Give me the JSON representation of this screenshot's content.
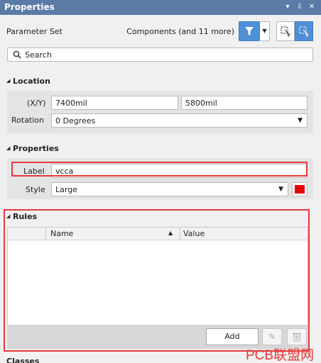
{
  "window": {
    "title": "Properties",
    "controls": [
      "▾",
      "⇩",
      "✕"
    ]
  },
  "parameter_set": {
    "label": "Parameter Set",
    "components": "Components (and 11 more)"
  },
  "search": {
    "placeholder": "Search"
  },
  "location": {
    "heading": "Location",
    "xy_label": "(X/Y)",
    "x_value": "7400mil",
    "y_value": "5800mil",
    "rotation_label": "Rotation",
    "rotation_value": "0 Degrees"
  },
  "properties": {
    "heading": "Properties",
    "label_label": "Label",
    "label_value": "vcca",
    "style_label": "Style",
    "style_value": "Large",
    "color": "#ee0000"
  },
  "rules": {
    "heading": "Rules",
    "columns": [
      "Name",
      "Value"
    ],
    "rows": [],
    "add_label": "Add"
  },
  "classes": {
    "heading": "Classes"
  },
  "watermark": "PCB联盟网",
  "colors": {
    "titlebar": "#5b7ba6",
    "accent": "#4f8fd6",
    "highlight": "#e43a3a"
  }
}
